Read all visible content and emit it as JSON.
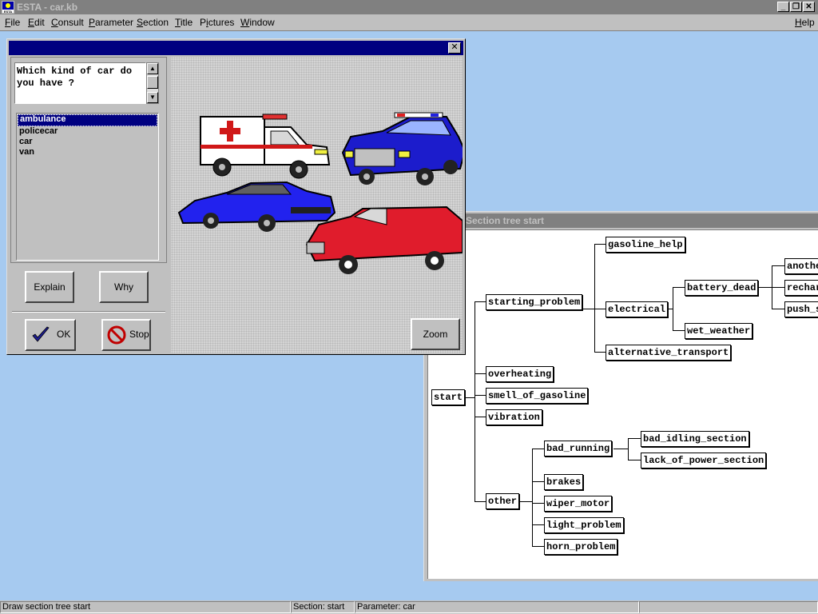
{
  "app": {
    "title": "ESTA - car.kb",
    "window_controls": [
      "minimize-icon",
      "restore-icon",
      "close-icon"
    ]
  },
  "menubar": {
    "items": [
      {
        "label": "File",
        "accel": "F"
      },
      {
        "label": "Edit",
        "accel": "E"
      },
      {
        "label": "Consult",
        "accel": "C"
      },
      {
        "label": "Parameter",
        "accel": "P"
      },
      {
        "label": "Section",
        "accel": "S"
      },
      {
        "label": "Title",
        "accel": "T"
      },
      {
        "label": "Pictures",
        "accel": "i"
      },
      {
        "label": "Window",
        "accel": "W"
      }
    ],
    "help": {
      "label": "Help",
      "accel": "H"
    }
  },
  "dialog": {
    "title": "",
    "question": "Which kind of car do you have ?",
    "answers": [
      {
        "label": "ambulance",
        "selected": true
      },
      {
        "label": "policecar",
        "selected": false
      },
      {
        "label": "car",
        "selected": false
      },
      {
        "label": "van",
        "selected": false
      }
    ],
    "buttons": {
      "explain": "Explain",
      "why": "Why",
      "ok": "OK",
      "stop": "Stop",
      "zoom": "Zoom"
    },
    "picture": {
      "vehicles": [
        "ambulance",
        "policecar",
        "car",
        "van"
      ],
      "colors": {
        "ambulance_body": "#ffffff",
        "ambulance_cross": "#e02020",
        "policecar_body": "#1c1ccc",
        "car_body": "#2222ee",
        "van_body": "#e01c2c"
      }
    }
  },
  "tree_window": {
    "title": "Section tree start",
    "nodes": {
      "start": "start",
      "starting_problem": "starting_problem",
      "overheating": "overheating",
      "smell_of_gasoline": "smell_of_gasoline",
      "vibration": "vibration",
      "other": "other",
      "gasoline_help": "gasoline_help",
      "electrical": "electrical",
      "alternative_transport": "alternative_transport",
      "battery_dead": "battery_dead",
      "wet_weather": "wet_weather",
      "another": "another",
      "recharge": "recharge",
      "push_start": "push_start",
      "bad_running": "bad_running",
      "brakes": "brakes",
      "wiper_motor": "wiper_motor",
      "light_problem": "light_problem",
      "horn_problem": "horn_problem",
      "bad_idling_section": "bad_idling_section",
      "lack_of_power_section": "lack_of_power_section"
    }
  },
  "statusbar": {
    "message": "Draw section tree start",
    "section": "Section: start",
    "parameter": "Parameter: car"
  },
  "colors": {
    "desktop": "#a6caf0",
    "face": "#c0c0c0",
    "active_title": "#000080",
    "inactive_title": "#808080",
    "selection": "#000080"
  }
}
